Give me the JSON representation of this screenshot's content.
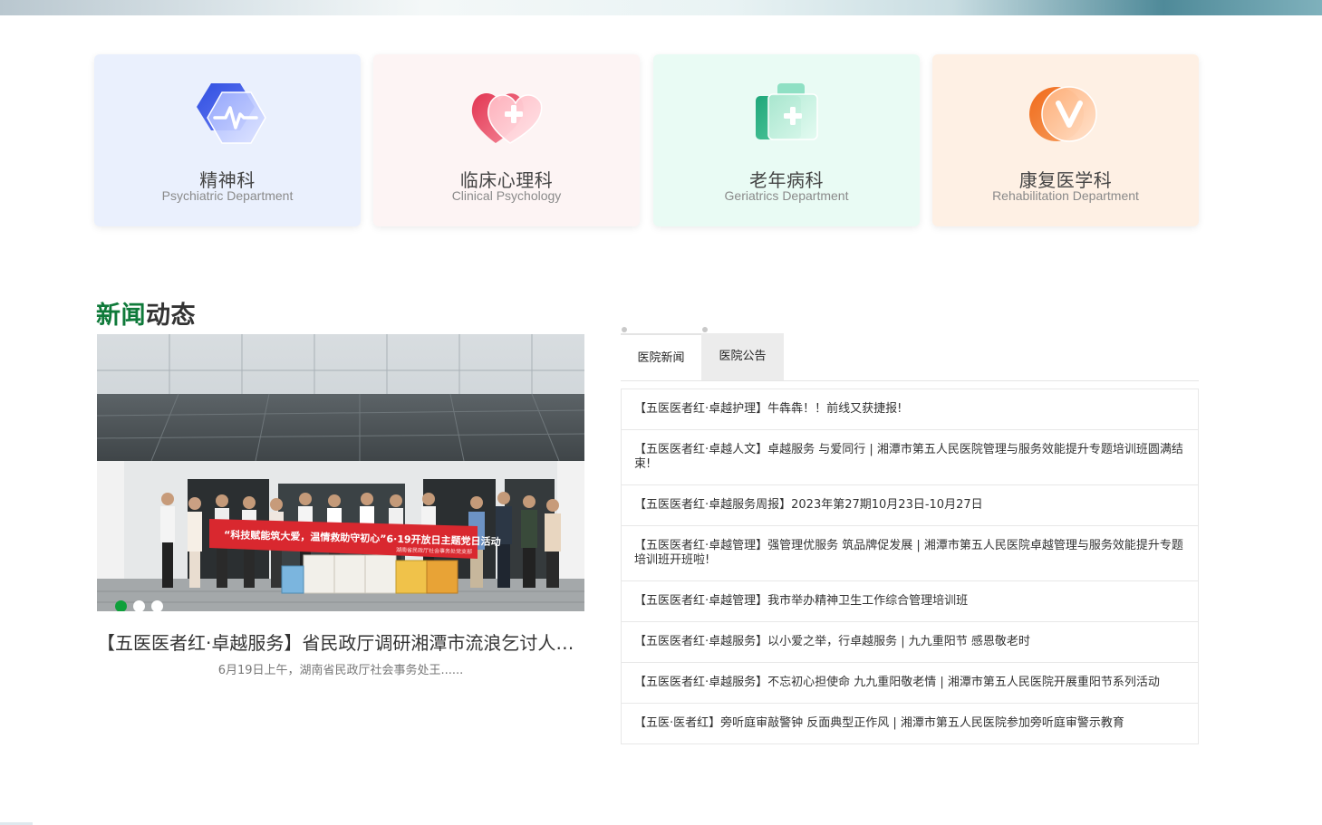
{
  "departments": [
    {
      "name": "精神科",
      "en": "Psychiatric Department",
      "icon": "heartbeat-shield-icon",
      "bg": "#eaf0fd"
    },
    {
      "name": "临床心理科",
      "en": "Clinical Psychology",
      "icon": "heart-plus-icon",
      "bg": "#fdf4f4"
    },
    {
      "name": "老年病科",
      "en": "Geriatrics Department",
      "icon": "medical-kit-icon",
      "bg": "#e9fbf4"
    },
    {
      "name": "康复医学科",
      "en": "Rehabilitation Department",
      "icon": "v-badge-icon",
      "bg": "#fef0e4"
    }
  ],
  "news_section": {
    "title_highlight": "新闻",
    "title_rest": "动态",
    "highlight_color": "#0f7a3a"
  },
  "slider": {
    "banner_text": "“科技赋能筑大爱，温情救助守初心”6·19开放日主题党日活动",
    "banner_sub": "湖南省民政厅社会事务处党支部",
    "caption": "【五医医者红·卓越服务】省民政厅调研湘潭市流浪乞讨人员救助管理工作",
    "summary": "6月19日上午，湖南省民政厅社会事务处王......",
    "dots": 3,
    "active_dot": 1
  },
  "tabs": [
    {
      "label": "医院新闻",
      "active": true
    },
    {
      "label": "医院公告",
      "active": false
    }
  ],
  "news_items": [
    "【五医医者红·卓越护理】牛犇犇！！前线又获捷报!",
    "【五医医者红·卓越人文】卓越服务 与爱同行 | 湘潭市第五人民医院管理与服务效能提升专题培训班圆满结束!",
    "【五医医者红·卓越服务周报】2023年第27期10月23日-10月27日",
    "【五医医者红·卓越管理】强管理优服务 筑品牌促发展 | 湘潭市第五人民医院卓越管理与服务效能提升专题培训班开班啦!",
    "【五医医者红·卓越管理】我市举办精神卫生工作综合管理培训班",
    "【五医医者红·卓越服务】以小爱之举，行卓越服务 | 九九重阳节 感恩敬老时",
    "【五医医者红·卓越服务】不忘初心担使命 九九重阳敬老情 | 湘潭市第五人民医院开展重阳节系列活动",
    "【五医·医者红】旁听庭审敲警钟 反面典型正作风 | 湘潭市第五人民医院参加旁听庭审警示教育"
  ]
}
